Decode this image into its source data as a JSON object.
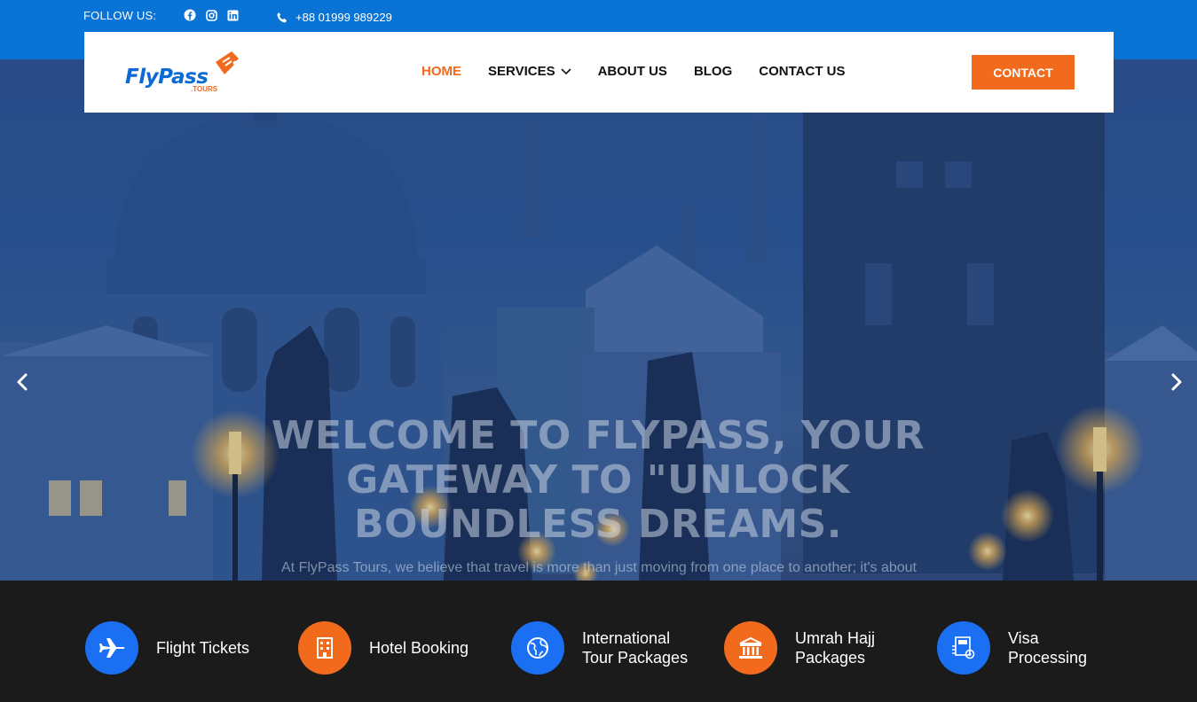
{
  "topbar": {
    "follow_label": "FOLLOW US:",
    "phone": "+88 01999 989229",
    "socials": [
      "facebook-icon",
      "instagram-icon",
      "linkedin-icon"
    ]
  },
  "brand": {
    "name_part1": "Fly",
    "name_part2": "Pass",
    "suffix": ".TOURS",
    "colors": {
      "blue": "#0b6ad4",
      "orange": "#f26a1b"
    }
  },
  "nav": {
    "items": [
      {
        "label": "HOME",
        "active": true
      },
      {
        "label": "SERVICES",
        "dropdown": true
      },
      {
        "label": "ABOUT US"
      },
      {
        "label": "BLOG"
      },
      {
        "label": "CONTACT US"
      }
    ],
    "cta_label": "CONTACT"
  },
  "hero": {
    "title": "WELCOME TO FLYPASS, YOUR GATEWAY TO \"UNLOCK BOUNDLESS DREAMS.",
    "subtitle": "At FlyPass Tours, we believe that travel is more than just moving from one place to another; it's about"
  },
  "services": [
    {
      "label": "Flight Tickets",
      "icon": "airplane-icon",
      "color": "#1b6ff2"
    },
    {
      "label": "Hotel Booking",
      "icon": "building-icon",
      "color": "#f26a1b"
    },
    {
      "label": "International Tour Packages",
      "line1": "International",
      "line2": "Tour Packages",
      "icon": "globe-icon",
      "color": "#1b6ff2"
    },
    {
      "label": "Umrah Hajj Packages",
      "line1": "Umrah Hajj",
      "line2": "Packages",
      "icon": "mosque-icon",
      "color": "#f26a1b"
    },
    {
      "label": "Visa Processing",
      "line1": "Visa",
      "line2": "Processing",
      "icon": "visa-document-icon",
      "color": "#1b6ff2"
    }
  ]
}
